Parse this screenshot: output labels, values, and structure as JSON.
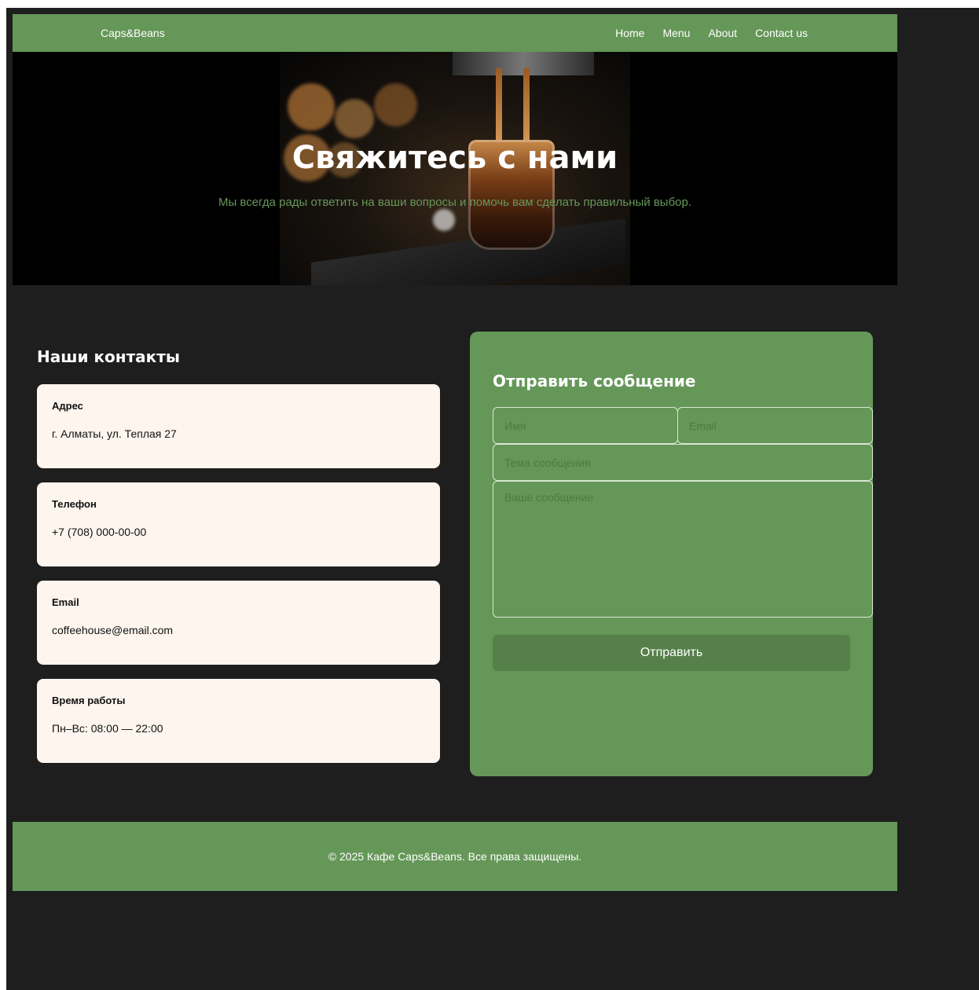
{
  "navbar": {
    "brand": "Caps&Beans",
    "links": [
      "Home",
      "Menu",
      "About",
      "Contact us"
    ]
  },
  "hero": {
    "title": "Свяжитесь с нами",
    "subtitle": "Мы всегда рады ответить на ваши вопросы и помочь вам сделать правильный выбор."
  },
  "contacts": {
    "title": "Наши контакты",
    "cards": [
      {
        "title": "Адрес",
        "value": "г. Алматы, ул. Теплая 27"
      },
      {
        "title": "Телефон",
        "value": "+7 (708) 000-00-00"
      },
      {
        "title": "Email",
        "value": "coffeehouse@email.com"
      },
      {
        "title": "Время работы",
        "value": "Пн–Вс: 08:00 — 22:00"
      }
    ]
  },
  "form": {
    "title": "Отправить сообщение",
    "name_placeholder": "Имя",
    "email_placeholder": "Email",
    "subject_placeholder": "Тема сообщения",
    "message_placeholder": "Ваше сообщение",
    "submit_label": "Отправить"
  },
  "footer": {
    "copyright": "© 2025 Кафе Caps&Beans. Все права защищены."
  },
  "colors": {
    "accent_green": "#659758",
    "button_green": "#55804a",
    "background": "#1e1e1e",
    "card_bg": "#fdf5ee"
  }
}
